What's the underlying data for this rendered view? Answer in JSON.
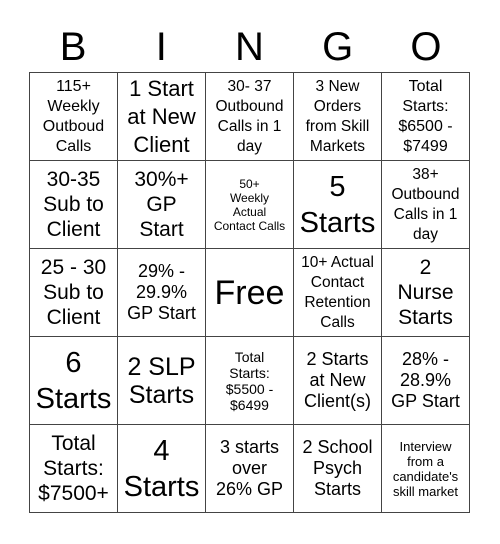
{
  "title": {
    "letters": [
      "B",
      "I",
      "N",
      "G",
      "O"
    ]
  },
  "cells": [
    [
      "115+\nWeekly\nOutboud\nCalls",
      "1 Start\nat New\nClient",
      "30- 37\nOutbound\nCalls in 1\nday",
      "3 New\nOrders\nfrom Skill\nMarkets",
      "Total\nStarts:\n$6500 -\n$7499"
    ],
    [
      "30-35\nSub to\nClient",
      "30%+\nGP\nStart",
      "50+\nWeekly\nActual\nContact Calls",
      "5\nStarts",
      "38+\nOutbound\nCalls in 1\nday"
    ],
    [
      "25 - 30\nSub to\nClient",
      "29% -\n29.9%\nGP Start",
      "Free",
      "10+ Actual\nContact\nRetention\nCalls",
      "2\nNurse\nStarts"
    ],
    [
      "6\nStarts",
      "2 SLP\nStarts",
      "Total\nStarts:\n$5500 -\n$6499",
      "2 Starts\nat New\nClient(s)",
      "28% -\n28.9%\nGP Start"
    ],
    [
      "Total\nStarts:\n$7500+",
      "4\nStarts",
      "3 starts\nover\n26% GP",
      "2 School\nPsych\nStarts",
      "Interview\nfrom a\ncandidate's\nskill market"
    ]
  ]
}
